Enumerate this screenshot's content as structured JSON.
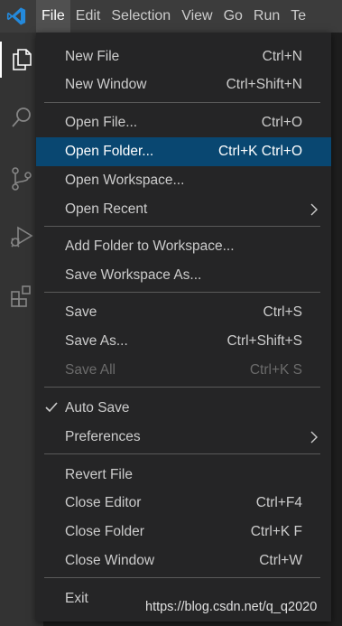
{
  "menubar": {
    "items": [
      {
        "label": "File"
      },
      {
        "label": "Edit"
      },
      {
        "label": "Selection"
      },
      {
        "label": "View"
      },
      {
        "label": "Go"
      },
      {
        "label": "Run"
      },
      {
        "label": "Te"
      }
    ]
  },
  "activitybar": {
    "icons": [
      "files-icon",
      "search-icon",
      "source-control-icon",
      "run-debug-icon",
      "extensions-icon"
    ]
  },
  "file_menu": {
    "new_file": {
      "label": "New File",
      "shortcut": "Ctrl+N"
    },
    "new_window": {
      "label": "New Window",
      "shortcut": "Ctrl+Shift+N"
    },
    "open_file": {
      "label": "Open File...",
      "shortcut": "Ctrl+O"
    },
    "open_folder": {
      "label": "Open Folder...",
      "shortcut": "Ctrl+K Ctrl+O"
    },
    "open_workspace": {
      "label": "Open Workspace..."
    },
    "open_recent": {
      "label": "Open Recent"
    },
    "add_folder": {
      "label": "Add Folder to Workspace..."
    },
    "save_workspace_as": {
      "label": "Save Workspace As..."
    },
    "save": {
      "label": "Save",
      "shortcut": "Ctrl+S"
    },
    "save_as": {
      "label": "Save As...",
      "shortcut": "Ctrl+Shift+S"
    },
    "save_all": {
      "label": "Save All",
      "shortcut": "Ctrl+K S"
    },
    "auto_save": {
      "label": "Auto Save",
      "checked": true
    },
    "preferences": {
      "label": "Preferences"
    },
    "revert_file": {
      "label": "Revert File"
    },
    "close_editor": {
      "label": "Close Editor",
      "shortcut": "Ctrl+F4"
    },
    "close_folder": {
      "label": "Close Folder",
      "shortcut": "Ctrl+K F"
    },
    "close_window": {
      "label": "Close Window",
      "shortcut": "Ctrl+W"
    },
    "exit": {
      "label": "Exit"
    }
  },
  "watermark": "https://blog.csdn.net/q_q2020",
  "colors": {
    "titlebar": "#3c3c3c",
    "activitybar": "#333333",
    "menu_bg": "#252526",
    "highlight": "#094771",
    "vscode_blue": "#2489db"
  }
}
